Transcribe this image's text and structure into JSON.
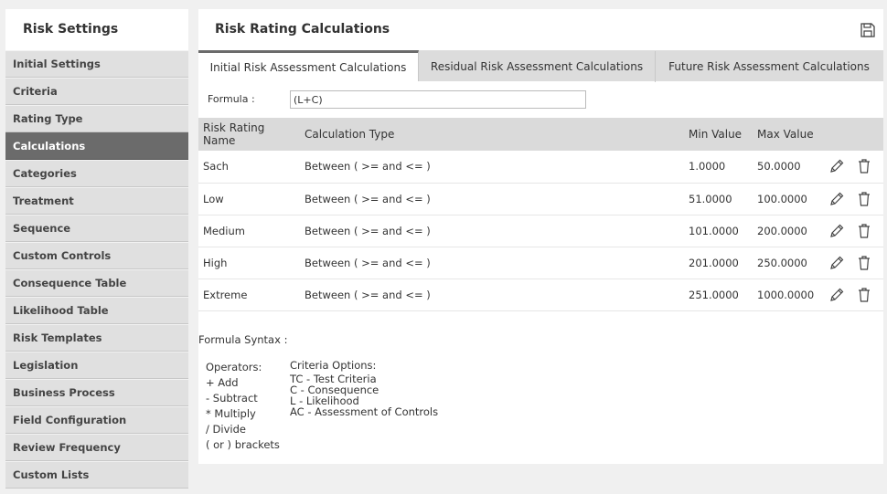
{
  "sidebar": {
    "title": "Risk Settings",
    "items": [
      {
        "label": "Initial Settings",
        "active": false
      },
      {
        "label": "Criteria",
        "active": false
      },
      {
        "label": "Rating Type",
        "active": false
      },
      {
        "label": "Calculations",
        "active": true
      },
      {
        "label": "Categories",
        "active": false
      },
      {
        "label": "Treatment",
        "active": false
      },
      {
        "label": "Sequence",
        "active": false
      },
      {
        "label": "Custom Controls",
        "active": false
      },
      {
        "label": "Consequence Table",
        "active": false
      },
      {
        "label": "Likelihood Table",
        "active": false
      },
      {
        "label": "Risk Templates",
        "active": false
      },
      {
        "label": "Legislation",
        "active": false
      },
      {
        "label": "Business Process",
        "active": false
      },
      {
        "label": "Field Configuration",
        "active": false
      },
      {
        "label": "Review Frequency",
        "active": false
      },
      {
        "label": "Custom Lists",
        "active": false
      }
    ]
  },
  "main": {
    "title": "Risk Rating Calculations",
    "tabs": [
      {
        "label": "Initial Risk Assessment Calculations",
        "active": true
      },
      {
        "label": "Residual Risk Assessment Calculations",
        "active": false
      },
      {
        "label": "Future Risk Assessment Calculations",
        "active": false
      }
    ],
    "formula_label": "Formula :",
    "formula_value": "(L+C)",
    "table": {
      "headers": [
        "Risk Rating Name",
        "Calculation Type",
        "Min Value",
        "Max Value"
      ],
      "rows": [
        {
          "name": "Sach",
          "type": "Between ( >= and <= )",
          "min": "1.0000",
          "max": "50.0000"
        },
        {
          "name": "Low",
          "type": "Between ( >= and <= )",
          "min": "51.0000",
          "max": "100.0000"
        },
        {
          "name": "Medium",
          "type": "Between ( >= and <= )",
          "min": "101.0000",
          "max": "200.0000"
        },
        {
          "name": "High",
          "type": "Between ( >= and <= )",
          "min": "201.0000",
          "max": "250.0000"
        },
        {
          "name": "Extreme",
          "type": "Between ( >= and <= )",
          "min": "251.0000",
          "max": "1000.0000"
        }
      ]
    },
    "syntax": {
      "label": "Formula Syntax :",
      "operators_title": "Operators:",
      "operators": [
        "+ Add",
        "- Subtract",
        "* Multiply",
        "/ Divide",
        "( or ) brackets"
      ],
      "criteria_title": "Criteria Options:",
      "criteria": [
        "TC - Test Criteria",
        "C - Consequence",
        "L - Likelihood",
        "AC - Assessment of Controls"
      ]
    }
  },
  "icons": {
    "save": "floppy-disk-icon",
    "edit": "pencil-icon",
    "delete": "trash-icon"
  },
  "colors": {
    "active_nav": "#6b6b6b",
    "tab_bar": "#dcdcdc",
    "header_row": "#dadada"
  }
}
